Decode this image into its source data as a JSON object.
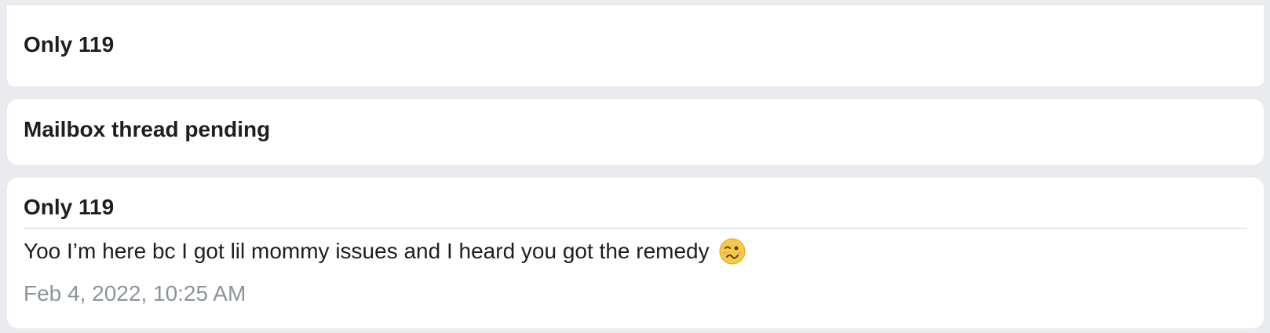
{
  "cards": [
    {
      "title": "Only 119"
    },
    {
      "title": "Mailbox thread pending"
    },
    {
      "title": "Only 119",
      "message": "Yoo I’m here bc I got lil mommy issues and I heard you got the remedy",
      "emoji": "woozy-face-icon",
      "timestamp": "Feb 4, 2022, 10:25 AM"
    }
  ],
  "colors": {
    "background": "#e9ebee",
    "card": "#ffffff",
    "text": "#1c1e21",
    "timestamp": "#8d949e",
    "divider": "#cfd2d6",
    "emoji": "#f7c948"
  }
}
